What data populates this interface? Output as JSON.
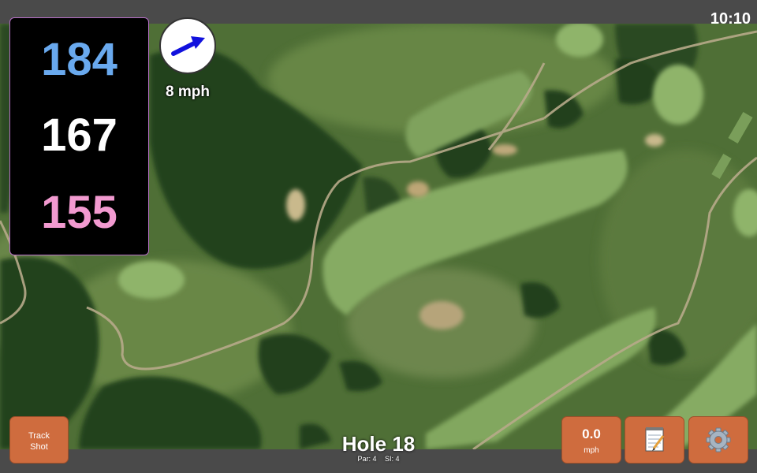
{
  "status_bar": {
    "time": "10:10"
  },
  "distances": {
    "back": "184",
    "middle": "167",
    "front": "155"
  },
  "wind": {
    "speed": "8 mph",
    "icon": "arrow-icon",
    "arrow_color": "#1111dd"
  },
  "hole": {
    "title": "Hole 18",
    "par": "Par: 4",
    "stroke_index": "SI: 4"
  },
  "buttons": {
    "track_shot_line1": "Track",
    "track_shot_line2": "Shot",
    "speed_value": "0.0",
    "speed_unit": "mph",
    "notes_icon": "notepad-icon",
    "settings_icon": "gear-icon"
  },
  "colors": {
    "back_distance": "#69a9ee",
    "middle_distance": "#ffffff",
    "front_distance": "#f29ad0",
    "button": "#cf6c3e",
    "panel_border": "#b76fc7"
  }
}
